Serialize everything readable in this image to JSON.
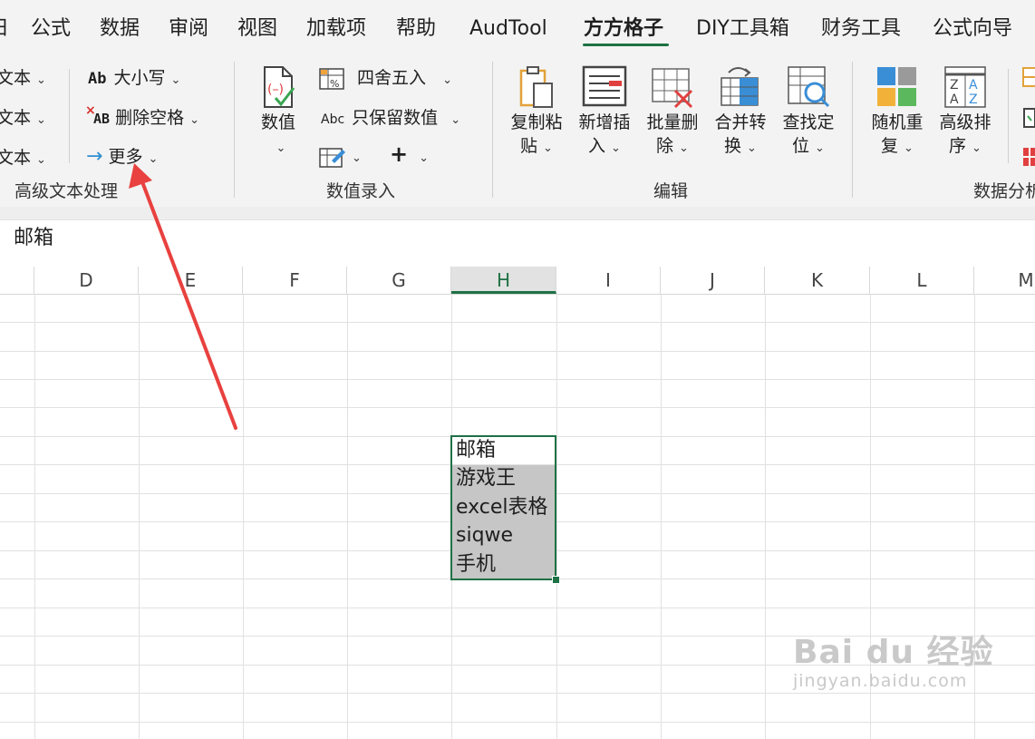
{
  "menu": {
    "tabs": [
      {
        "label": "日",
        "partial": true
      },
      {
        "label": "公式"
      },
      {
        "label": "数据"
      },
      {
        "label": "审阅"
      },
      {
        "label": "视图"
      },
      {
        "label": "加载项"
      },
      {
        "label": "帮助"
      },
      {
        "label": "AudTool"
      },
      {
        "label": "方方格子",
        "active": true
      },
      {
        "label": "DIY工具箱"
      },
      {
        "label": "财务工具"
      },
      {
        "label": "公式向导"
      }
    ]
  },
  "ribbon": {
    "text_group": {
      "cut_items": [
        "文本",
        "文本",
        "文本"
      ],
      "case_label": "大小写",
      "case_icon_text": "Ab",
      "trim_label": "删除空格",
      "trim_icon_text": "AB",
      "more_label": "更多",
      "group_label": "高级文本处理"
    },
    "number_group": {
      "value_label": "数值",
      "round_label": "四舍五入",
      "keep_value_label": "只保留数值",
      "keep_value_icon_text": "Abc",
      "plus_label": "+",
      "group_label": "数值录入"
    },
    "edit_group": {
      "copy_paste": [
        "复制粘",
        "贴"
      ],
      "insert": [
        "新增插",
        "入"
      ],
      "batch_delete": [
        "批量删",
        "除"
      ],
      "merge_convert": [
        "合并转",
        "换"
      ],
      "find_locate": [
        "查找定",
        "位"
      ],
      "group_label": "编辑"
    },
    "data_group": {
      "random_repeat": [
        "随机重",
        "复"
      ],
      "advanced_sort": [
        "高级排",
        "序"
      ],
      "group_label": "数据分析"
    }
  },
  "formula_bar": {
    "value": "邮箱"
  },
  "columns": [
    "D",
    "E",
    "F",
    "G",
    "H",
    "I",
    "J",
    "K",
    "L",
    "M"
  ],
  "selected_column": "H",
  "cells": [
    {
      "ref": "H1",
      "value": "邮箱"
    },
    {
      "ref": "H2",
      "value": "游戏王"
    },
    {
      "ref": "H3",
      "value": "excel表格"
    },
    {
      "ref": "H4",
      "value": "siqwe"
    },
    {
      "ref": "H5",
      "value": "手机"
    }
  ],
  "watermark": {
    "logo": "Bai du 经验",
    "url": "jingyan.baidu.com"
  },
  "colors": {
    "accent_green": "#1e7145",
    "arrow_red": "#e8413f",
    "selection_shade": "#c6c6c6"
  }
}
